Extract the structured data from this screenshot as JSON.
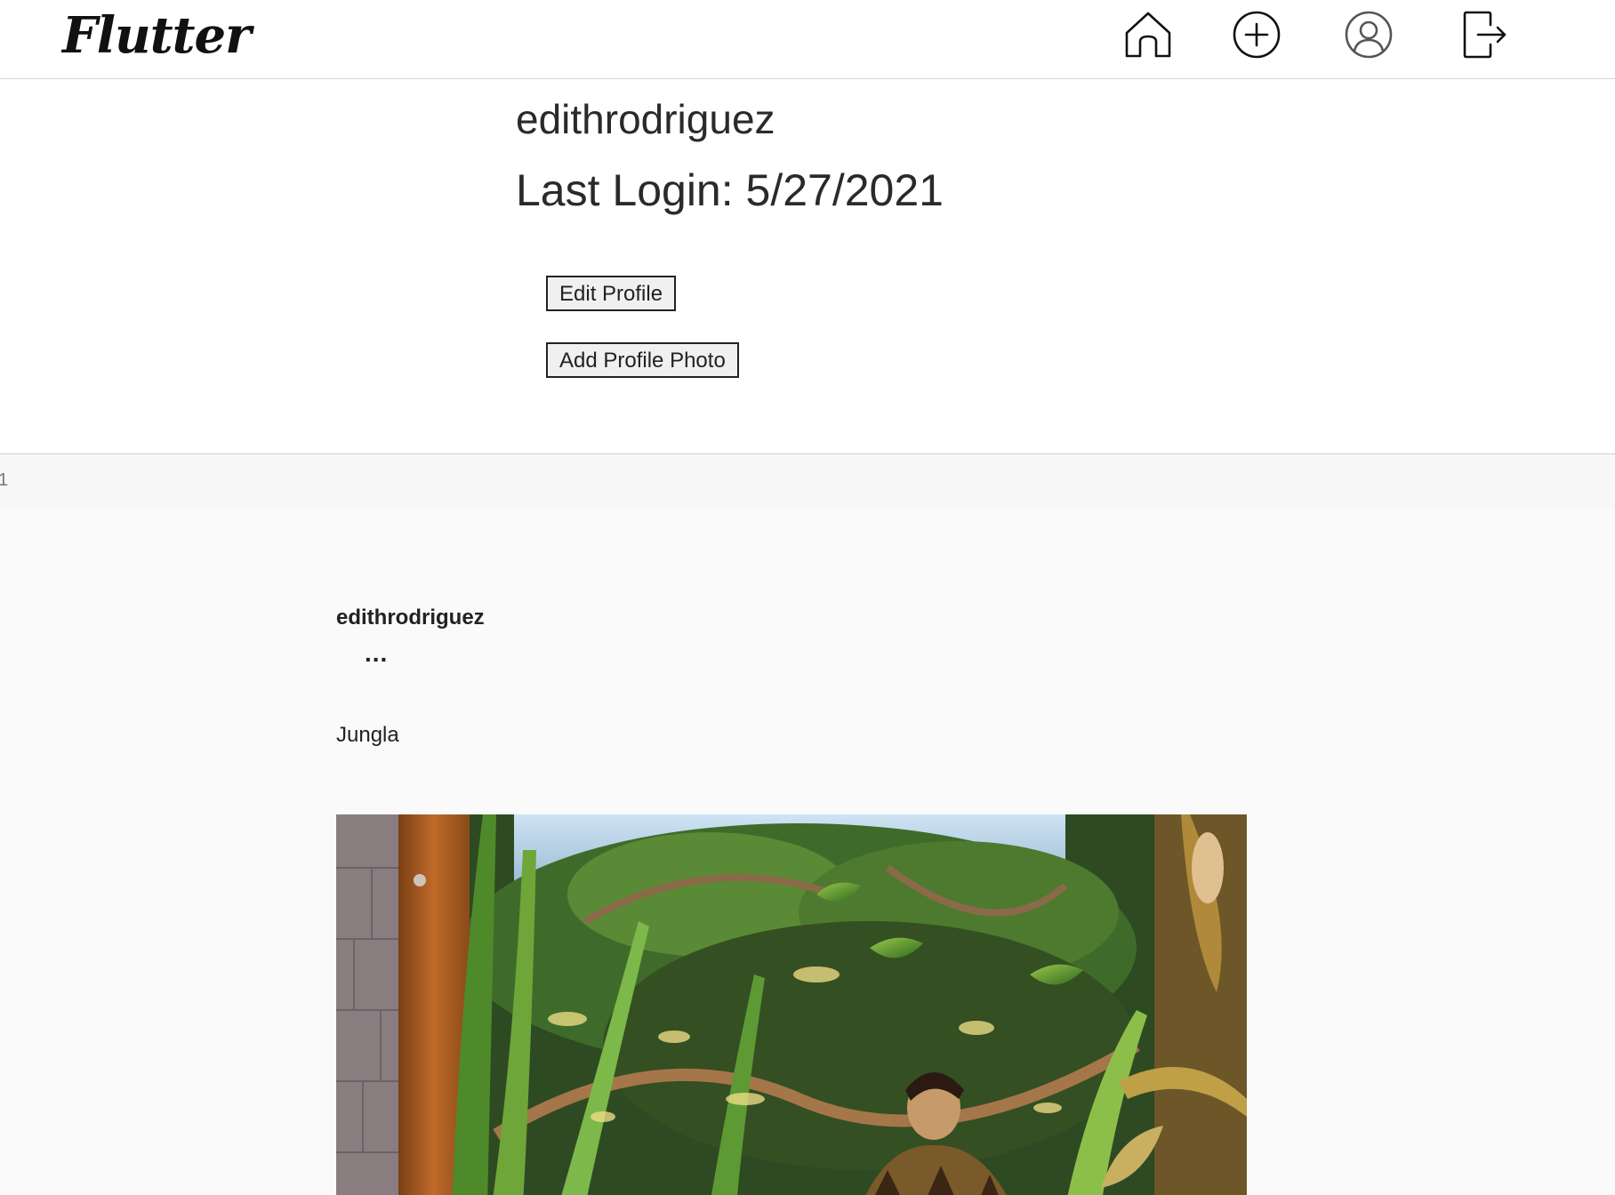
{
  "navbar": {
    "logo_text": "Flutter",
    "icons": [
      "home-icon",
      "add-circle-icon",
      "user-profile-icon",
      "logout-icon"
    ]
  },
  "profile": {
    "username": "edithrodriguez",
    "last_login": "Last Login: 5/27/2021",
    "edit_profile_label": "Edit Profile",
    "add_photo_label": "Add Profile Photo"
  },
  "strip": {
    "text": "1"
  },
  "post": {
    "author": "edithrodriguez",
    "menu_label": "...",
    "caption": "Jungla"
  }
}
